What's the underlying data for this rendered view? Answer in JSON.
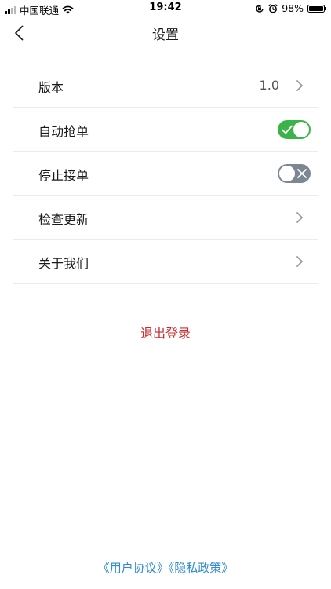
{
  "status_bar": {
    "carrier": "中国联通",
    "time": "19:42",
    "battery": "98%",
    "battery_level": 0.98
  },
  "nav": {
    "title": "设置"
  },
  "settings": [
    {
      "label": "版本",
      "value": "1.0"
    },
    {
      "label": "自动抢单",
      "toggle": true
    },
    {
      "label": "停止接单",
      "toggle": false
    },
    {
      "label": "检查更新"
    },
    {
      "label": "关于我们"
    }
  ],
  "logout_label": "退出登录",
  "footer": {
    "user_agreement": "《用户协议》",
    "privacy_policy": "《隐私政策》"
  },
  "colors": {
    "toggle_on": "#3cb34a",
    "toggle_off": "#7d8794",
    "logout": "#d0282c",
    "link": "#2f8bd0"
  }
}
